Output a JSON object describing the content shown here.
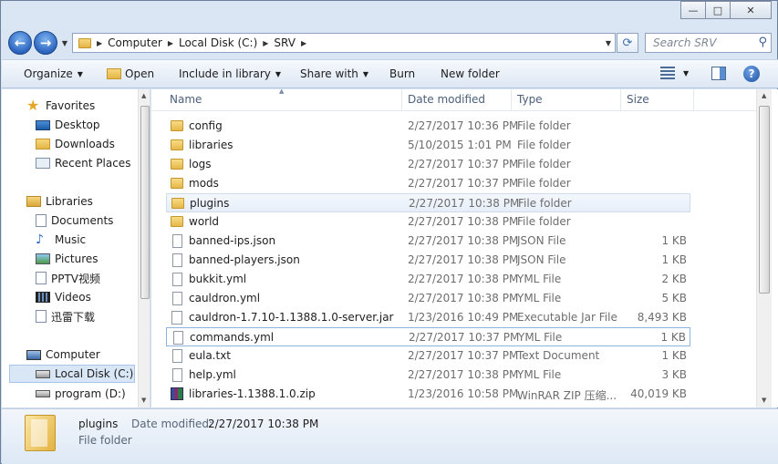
{
  "window": {
    "caption": {
      "minimize": "—",
      "maximize": "□",
      "close": "✕"
    }
  },
  "nav": {
    "back": "←",
    "forward": "→",
    "breadcrumb": [
      "Computer",
      "Local Disk (C:)",
      "SRV"
    ],
    "refresh_icon": "⟳",
    "search_placeholder": "Search SRV"
  },
  "toolbar": {
    "organize": "Organize",
    "open": "Open",
    "include": "Include in library",
    "share": "Share with",
    "burn": "Burn",
    "new_folder": "New folder",
    "help": "?"
  },
  "sidebar": {
    "favorites": "Favorites",
    "desktop": "Desktop",
    "downloads": "Downloads",
    "recent": "Recent Places",
    "libraries": "Libraries",
    "documents": "Documents",
    "music": "Music",
    "pictures": "Pictures",
    "pptv": "PPTV视频",
    "videos": "Videos",
    "xunlei": "迅雷下载",
    "computer": "Computer",
    "local_c": "Local Disk (C:)",
    "program_d": "program (D:)"
  },
  "columns": {
    "name": "Name",
    "date": "Date modified",
    "type": "Type",
    "size": "Size"
  },
  "files": [
    {
      "name": "config",
      "date": "2/27/2017 10:36 PM",
      "type": "File folder",
      "size": "",
      "icon": "folder"
    },
    {
      "name": "libraries",
      "date": "5/10/2015 1:01 PM",
      "type": "File folder",
      "size": "",
      "icon": "folder"
    },
    {
      "name": "logs",
      "date": "2/27/2017 10:37 PM",
      "type": "File folder",
      "size": "",
      "icon": "folder"
    },
    {
      "name": "mods",
      "date": "2/27/2017 10:37 PM",
      "type": "File folder",
      "size": "",
      "icon": "folder"
    },
    {
      "name": "plugins",
      "date": "2/27/2017 10:38 PM",
      "type": "File folder",
      "size": "",
      "icon": "folder"
    },
    {
      "name": "world",
      "date": "2/27/2017 10:38 PM",
      "type": "File folder",
      "size": "",
      "icon": "folder"
    },
    {
      "name": "banned-ips.json",
      "date": "2/27/2017 10:38 PM",
      "type": "JSON File",
      "size": "1 KB",
      "icon": "doc"
    },
    {
      "name": "banned-players.json",
      "date": "2/27/2017 10:38 PM",
      "type": "JSON File",
      "size": "1 KB",
      "icon": "doc"
    },
    {
      "name": "bukkit.yml",
      "date": "2/27/2017 10:38 PM",
      "type": "YML File",
      "size": "2 KB",
      "icon": "doc"
    },
    {
      "name": "cauldron.yml",
      "date": "2/27/2017 10:38 PM",
      "type": "YML File",
      "size": "5 KB",
      "icon": "doc"
    },
    {
      "name": "cauldron-1.7.10-1.1388.1.0-server.jar",
      "date": "1/23/2016 10:49 PM",
      "type": "Executable Jar File",
      "size": "8,493 KB",
      "icon": "jar"
    },
    {
      "name": "commands.yml",
      "date": "2/27/2017 10:37 PM",
      "type": "YML File",
      "size": "1 KB",
      "icon": "doc"
    },
    {
      "name": "eula.txt",
      "date": "2/27/2017 10:37 PM",
      "type": "Text Document",
      "size": "1 KB",
      "icon": "doc"
    },
    {
      "name": "help.yml",
      "date": "2/27/2017 10:38 PM",
      "type": "YML File",
      "size": "3 KB",
      "icon": "doc"
    },
    {
      "name": "libraries-1.1388.1.0.zip",
      "date": "1/23/2016 10:58 PM",
      "type": "WinRAR ZIP 压缩...",
      "size": "40,019 KB",
      "icon": "zip"
    }
  ],
  "details": {
    "name": "plugins",
    "modified_label": "Date modified:",
    "modified_value": "2/27/2017 10:38 PM",
    "type": "File folder"
  }
}
